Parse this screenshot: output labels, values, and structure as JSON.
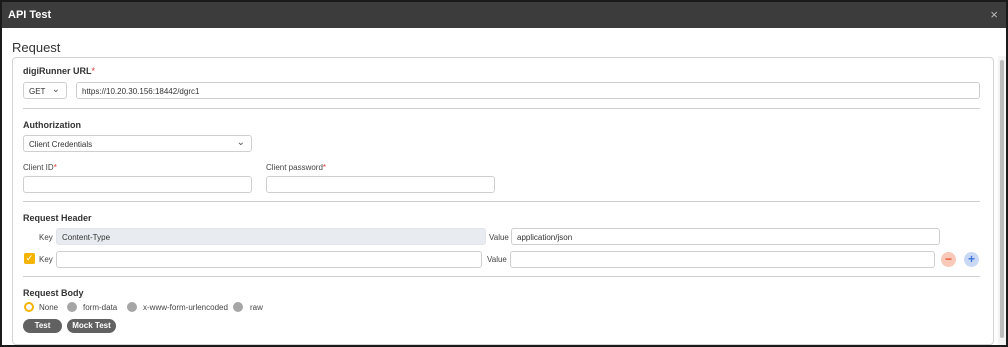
{
  "dialog": {
    "title": "API Test",
    "close_icon": "×"
  },
  "request": {
    "title": "Request",
    "url_section": {
      "label": "digiRunner URL",
      "method": "GET",
      "url": "https://10.20.30.156:18442/dgrc1"
    },
    "authorization": {
      "label": "Authorization",
      "type": "Client Credentials",
      "client_id_label": "Client ID",
      "client_id_value": "",
      "client_password_label": "Client password",
      "client_password_value": ""
    },
    "header": {
      "label": "Request Header",
      "rows": [
        {
          "key_label": "Key",
          "key": "Content-Type",
          "value_label": "Value",
          "value": "application/json",
          "checked": false
        },
        {
          "key_label": "Key",
          "key": "",
          "value_label": "Value",
          "value": "",
          "checked": true
        }
      ]
    },
    "body": {
      "label": "Request Body",
      "options": [
        "None",
        "form-data",
        "x-www-form-urlencoded",
        "raw"
      ],
      "selected": "None"
    },
    "buttons": {
      "test": "Test",
      "mock_test": "Mock Test"
    }
  },
  "required_mark": "*",
  "colors": {
    "accent": "#f5b400",
    "titlebar": "#3c3c3c",
    "remove": "#e5542b",
    "add": "#3b73d6"
  },
  "icons": {
    "checkbox": "check-icon",
    "remove": "minus-icon",
    "add": "plus-icon",
    "chevron": "chevron-down-icon"
  }
}
